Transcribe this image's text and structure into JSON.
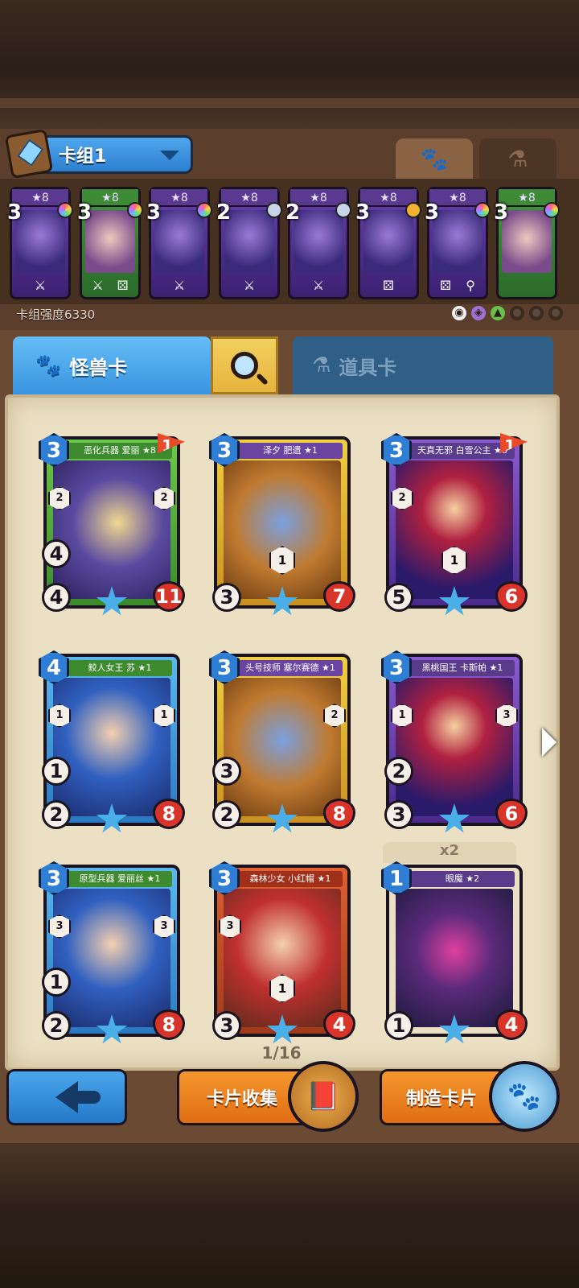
{
  "deck": {
    "name": "卡组1",
    "power_label": "卡组强度6330",
    "tabs": [
      "paw-icon",
      "potion-icon"
    ],
    "cards": [
      {
        "stars": "★8",
        "cost": "3",
        "gem": "rainbow",
        "foot": [
          "⚔"
        ],
        "color": "purple"
      },
      {
        "stars": "★8",
        "cost": "3",
        "gem": "rainbow",
        "foot": [
          "⚔",
          "⚄"
        ],
        "color": "green"
      },
      {
        "stars": "★8",
        "cost": "3",
        "gem": "rainbow",
        "foot": [
          "⚔"
        ],
        "color": "purple"
      },
      {
        "stars": "★8",
        "cost": "2",
        "gem": "silver",
        "foot": [
          "⚔"
        ],
        "color": "purple"
      },
      {
        "stars": "★8",
        "cost": "2",
        "gem": "silver",
        "foot": [
          "⚔"
        ],
        "color": "purple"
      },
      {
        "stars": "★8",
        "cost": "3",
        "gem": "gold",
        "foot": [
          "⚄"
        ],
        "color": "purple"
      },
      {
        "stars": "★8",
        "cost": "3",
        "gem": "rainbow",
        "foot": [
          "⚄",
          "⚲"
        ],
        "color": "purple"
      },
      {
        "stars": "★8",
        "cost": "3",
        "gem": "rainbow",
        "foot": [],
        "color": "green"
      }
    ]
  },
  "tabs": {
    "monster": "怪兽卡",
    "items": "道具卡"
  },
  "collection": {
    "cards": [
      {
        "title": "恶化兵器 爱丽 ★8",
        "cost": "3",
        "flag": "1",
        "left_stat": "4",
        "bottom_stat": "4",
        "hp": "11",
        "side_left": "2",
        "side_right": "2",
        "color": "green"
      },
      {
        "title": "泽夕 肥遗 ★1",
        "cost": "3",
        "flag": "",
        "left_stat": "",
        "bottom_stat": "3",
        "hp": "7",
        "side_left": "",
        "side_right": "",
        "mid": "1",
        "color": "yellow"
      },
      {
        "title": "天真无邪 白雪公主 ★8",
        "cost": "3",
        "flag": "1",
        "left_stat": "",
        "bottom_stat": "5",
        "hp": "6",
        "side_left": "2",
        "side_right": "",
        "mid": "1",
        "color": "purple"
      },
      {
        "title": "鲛人女王 苏 ★1",
        "cost": "4",
        "flag": "",
        "left_stat": "1",
        "bottom_stat": "2",
        "hp": "8",
        "side_left": "1",
        "side_right": "1",
        "color": "blue"
      },
      {
        "title": "头号技师 塞尔赛德 ★1",
        "cost": "3",
        "flag": "",
        "left_stat": "3",
        "bottom_stat": "2",
        "hp": "8",
        "side_left": "",
        "side_right": "2",
        "color": "yellow"
      },
      {
        "title": "黑桃国王 卡斯帕 ★1",
        "cost": "3",
        "flag": "",
        "left_stat": "2",
        "bottom_stat": "3",
        "hp": "6",
        "side_left": "1",
        "side_right": "3",
        "color": "purple"
      },
      {
        "title": "原型兵器 爱丽丝 ★1",
        "cost": "3",
        "flag": "",
        "left_stat": "1",
        "bottom_stat": "2",
        "hp": "8",
        "side_left": "3",
        "side_right": "3",
        "color": "blue"
      },
      {
        "title": "森林少女 小红帽 ★1",
        "cost": "3",
        "flag": "",
        "left_stat": "",
        "bottom_stat": "3",
        "hp": "4",
        "side_left": "3",
        "side_right": "",
        "mid": "1",
        "color": "red"
      },
      {
        "title": "眼魔 ★2",
        "cost": "1",
        "flag": "",
        "left_stat": "",
        "bottom_stat": "1",
        "hp": "4",
        "side_left": "",
        "side_right": "",
        "color": "dark",
        "dup": "x2"
      }
    ],
    "page": "1/16"
  },
  "buttons": {
    "collect": "卡片收集",
    "craft": "制造卡片"
  }
}
